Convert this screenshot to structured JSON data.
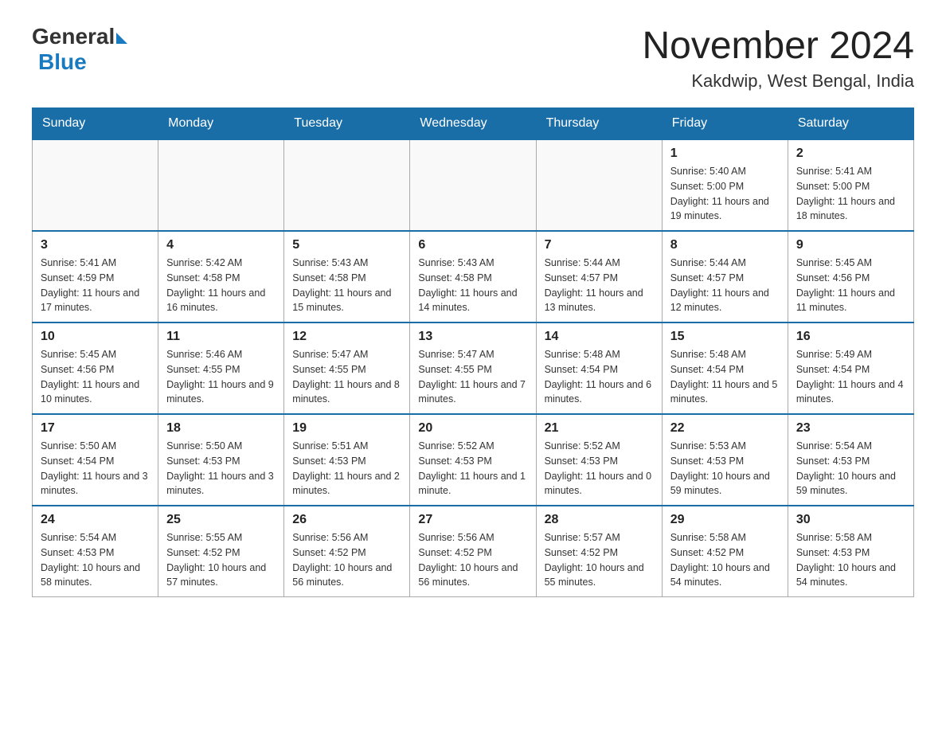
{
  "header": {
    "logo_general": "General",
    "logo_blue": "Blue",
    "title": "November 2024",
    "location": "Kakdwip, West Bengal, India"
  },
  "days_of_week": [
    "Sunday",
    "Monday",
    "Tuesday",
    "Wednesday",
    "Thursday",
    "Friday",
    "Saturday"
  ],
  "weeks": [
    [
      {
        "day": "",
        "info": ""
      },
      {
        "day": "",
        "info": ""
      },
      {
        "day": "",
        "info": ""
      },
      {
        "day": "",
        "info": ""
      },
      {
        "day": "",
        "info": ""
      },
      {
        "day": "1",
        "info": "Sunrise: 5:40 AM\nSunset: 5:00 PM\nDaylight: 11 hours and 19 minutes."
      },
      {
        "day": "2",
        "info": "Sunrise: 5:41 AM\nSunset: 5:00 PM\nDaylight: 11 hours and 18 minutes."
      }
    ],
    [
      {
        "day": "3",
        "info": "Sunrise: 5:41 AM\nSunset: 4:59 PM\nDaylight: 11 hours and 17 minutes."
      },
      {
        "day": "4",
        "info": "Sunrise: 5:42 AM\nSunset: 4:58 PM\nDaylight: 11 hours and 16 minutes."
      },
      {
        "day": "5",
        "info": "Sunrise: 5:43 AM\nSunset: 4:58 PM\nDaylight: 11 hours and 15 minutes."
      },
      {
        "day": "6",
        "info": "Sunrise: 5:43 AM\nSunset: 4:58 PM\nDaylight: 11 hours and 14 minutes."
      },
      {
        "day": "7",
        "info": "Sunrise: 5:44 AM\nSunset: 4:57 PM\nDaylight: 11 hours and 13 minutes."
      },
      {
        "day": "8",
        "info": "Sunrise: 5:44 AM\nSunset: 4:57 PM\nDaylight: 11 hours and 12 minutes."
      },
      {
        "day": "9",
        "info": "Sunrise: 5:45 AM\nSunset: 4:56 PM\nDaylight: 11 hours and 11 minutes."
      }
    ],
    [
      {
        "day": "10",
        "info": "Sunrise: 5:45 AM\nSunset: 4:56 PM\nDaylight: 11 hours and 10 minutes."
      },
      {
        "day": "11",
        "info": "Sunrise: 5:46 AM\nSunset: 4:55 PM\nDaylight: 11 hours and 9 minutes."
      },
      {
        "day": "12",
        "info": "Sunrise: 5:47 AM\nSunset: 4:55 PM\nDaylight: 11 hours and 8 minutes."
      },
      {
        "day": "13",
        "info": "Sunrise: 5:47 AM\nSunset: 4:55 PM\nDaylight: 11 hours and 7 minutes."
      },
      {
        "day": "14",
        "info": "Sunrise: 5:48 AM\nSunset: 4:54 PM\nDaylight: 11 hours and 6 minutes."
      },
      {
        "day": "15",
        "info": "Sunrise: 5:48 AM\nSunset: 4:54 PM\nDaylight: 11 hours and 5 minutes."
      },
      {
        "day": "16",
        "info": "Sunrise: 5:49 AM\nSunset: 4:54 PM\nDaylight: 11 hours and 4 minutes."
      }
    ],
    [
      {
        "day": "17",
        "info": "Sunrise: 5:50 AM\nSunset: 4:54 PM\nDaylight: 11 hours and 3 minutes."
      },
      {
        "day": "18",
        "info": "Sunrise: 5:50 AM\nSunset: 4:53 PM\nDaylight: 11 hours and 3 minutes."
      },
      {
        "day": "19",
        "info": "Sunrise: 5:51 AM\nSunset: 4:53 PM\nDaylight: 11 hours and 2 minutes."
      },
      {
        "day": "20",
        "info": "Sunrise: 5:52 AM\nSunset: 4:53 PM\nDaylight: 11 hours and 1 minute."
      },
      {
        "day": "21",
        "info": "Sunrise: 5:52 AM\nSunset: 4:53 PM\nDaylight: 11 hours and 0 minutes."
      },
      {
        "day": "22",
        "info": "Sunrise: 5:53 AM\nSunset: 4:53 PM\nDaylight: 10 hours and 59 minutes."
      },
      {
        "day": "23",
        "info": "Sunrise: 5:54 AM\nSunset: 4:53 PM\nDaylight: 10 hours and 59 minutes."
      }
    ],
    [
      {
        "day": "24",
        "info": "Sunrise: 5:54 AM\nSunset: 4:53 PM\nDaylight: 10 hours and 58 minutes."
      },
      {
        "day": "25",
        "info": "Sunrise: 5:55 AM\nSunset: 4:52 PM\nDaylight: 10 hours and 57 minutes."
      },
      {
        "day": "26",
        "info": "Sunrise: 5:56 AM\nSunset: 4:52 PM\nDaylight: 10 hours and 56 minutes."
      },
      {
        "day": "27",
        "info": "Sunrise: 5:56 AM\nSunset: 4:52 PM\nDaylight: 10 hours and 56 minutes."
      },
      {
        "day": "28",
        "info": "Sunrise: 5:57 AM\nSunset: 4:52 PM\nDaylight: 10 hours and 55 minutes."
      },
      {
        "day": "29",
        "info": "Sunrise: 5:58 AM\nSunset: 4:52 PM\nDaylight: 10 hours and 54 minutes."
      },
      {
        "day": "30",
        "info": "Sunrise: 5:58 AM\nSunset: 4:53 PM\nDaylight: 10 hours and 54 minutes."
      }
    ]
  ]
}
